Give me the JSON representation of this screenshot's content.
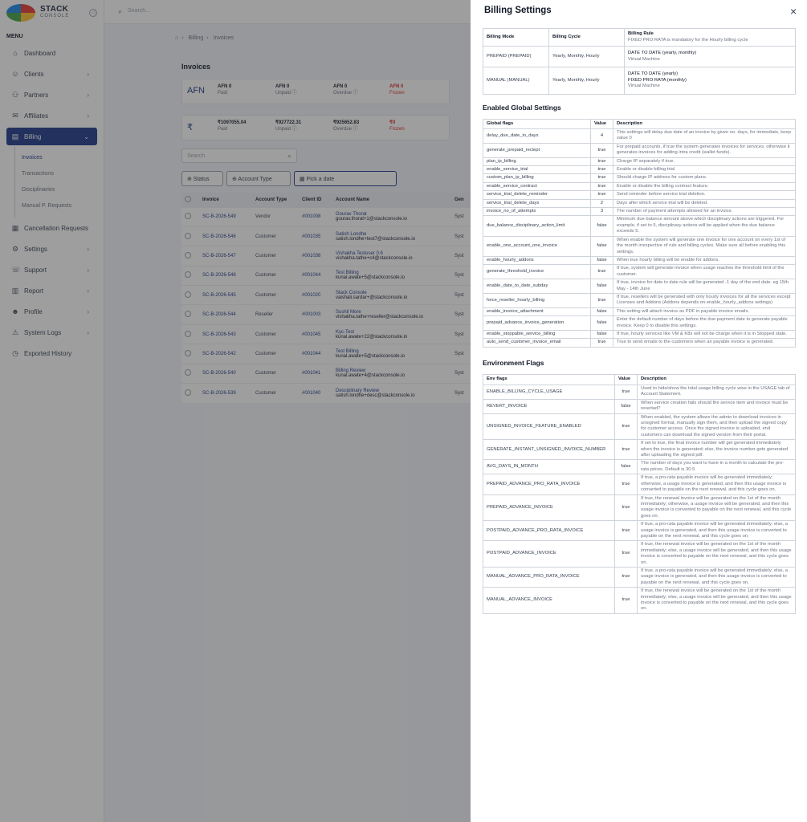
{
  "app": {
    "brand_line1": "STACK",
    "brand_line2": "CONSOLE",
    "menu_label": "MENU",
    "search_placeholder": "Search...",
    "nav": [
      {
        "label": "Dashboard",
        "icon": "home-icon",
        "glyph": "⌂",
        "chevron": false
      },
      {
        "label": "Clients",
        "icon": "user-icon",
        "glyph": "☺",
        "chevron": true
      },
      {
        "label": "Partners",
        "icon": "users-icon",
        "glyph": "⚇",
        "chevron": true
      },
      {
        "label": "Affiliates",
        "icon": "handshake-icon",
        "glyph": "✉",
        "chevron": true
      },
      {
        "label": "Billing",
        "icon": "billing-icon",
        "glyph": "▤",
        "chevron": true,
        "active": true
      },
      {
        "label": "Cancellation Requests",
        "icon": "cancel-icon",
        "glyph": "▦",
        "chevron": false
      },
      {
        "label": "Settings",
        "icon": "gear-icon",
        "glyph": "⚙",
        "chevron": true
      },
      {
        "label": "Support",
        "icon": "headset-icon",
        "glyph": "☏",
        "chevron": true
      },
      {
        "label": "Report",
        "icon": "report-icon",
        "glyph": "▥",
        "chevron": true
      },
      {
        "label": "Profile",
        "icon": "profile-icon",
        "glyph": "☻",
        "chevron": true
      },
      {
        "label": "System Logs",
        "icon": "warning-icon",
        "glyph": "⚠",
        "chevron": true
      },
      {
        "label": "Exported History",
        "icon": "history-icon",
        "glyph": "◷",
        "chevron": false
      }
    ],
    "billing_sub": [
      "Invoices",
      "Transactions",
      "Disciplinaries",
      "Manual P. Requests"
    ],
    "breadcrumb": [
      "Billing",
      "Invoices"
    ],
    "page_title": "Invoices",
    "cards": [
      {
        "currency": "AFN",
        "stats": [
          {
            "value": "AFN 0",
            "label": "Paid"
          },
          {
            "value": "AFN 0",
            "label": "Unpaid ⓘ"
          },
          {
            "value": "AFN 0",
            "label": "Overdue ⓘ"
          },
          {
            "value": "AFN 0",
            "label": "Frozen",
            "red": true
          }
        ]
      },
      {
        "currency": "₹",
        "stats": [
          {
            "value": "₹1097055.04",
            "label": "Paid"
          },
          {
            "value": "₹927722.31",
            "label": "Unpaid ⓘ"
          },
          {
            "value": "₹925652.83",
            "label": "Overdue ⓘ"
          },
          {
            "value": "₹0",
            "label": "Frozen",
            "red": true
          }
        ]
      }
    ],
    "search_label": "Search",
    "filters": [
      "⊕  Status",
      "⊕  Account Type",
      "▦  Pick a date"
    ],
    "table_headers": [
      "",
      "Invoice",
      "Account Type",
      "Client ID",
      "Account Name",
      "Gen"
    ],
    "rows": [
      {
        "invoice": "SC-B-2026-549",
        "type": "Vendor",
        "cid": "#001008",
        "name": "Gourav Thorat",
        "email": "gourav.thorat+1@stackconsole.io",
        "gen": "Syst"
      },
      {
        "invoice": "SC-B-2026-546",
        "type": "Customer",
        "cid": "#001035",
        "name": "Satish Londhe",
        "email": "satish.londhe+test7@stackconsole.io",
        "gen": "Syst"
      },
      {
        "invoice": "SC-B-2026-547",
        "type": "Customer",
        "cid": "#001038",
        "name": "Vishakha Testuser 0.6",
        "email": "vishakha.tathe+c4@stackconsole.io",
        "gen": "Syst"
      },
      {
        "invoice": "SC-B-2026-548",
        "type": "Customer",
        "cid": "#001044",
        "name": "Test Billing",
        "email": "kunal.awate+5@stackconsole.io",
        "gen": "Syst"
      },
      {
        "invoice": "SC-B-2026-545",
        "type": "Customer",
        "cid": "#001020",
        "name": "Stack Console",
        "email": "vaishali.sardar+@stackconsole.io",
        "gen": "Syst"
      },
      {
        "invoice": "SC-B-2026-544",
        "type": "Reseller",
        "cid": "#001003",
        "name": "Sushil More",
        "email": "vishakha.tathe+reseller@stackconsole.io",
        "gen": "Syst"
      },
      {
        "invoice": "SC-B-2026-543",
        "type": "Customer",
        "cid": "#001045",
        "name": "Kyc-Test",
        "email": "kunal.awate+22@stackconsole.in",
        "gen": "Syst"
      },
      {
        "invoice": "SC-B-2026-542",
        "type": "Customer",
        "cid": "#001044",
        "name": "Test Billing",
        "email": "kunal.awate+5@stackconsole.io",
        "gen": "Syst"
      },
      {
        "invoice": "SC-B-2026-540",
        "type": "Customer",
        "cid": "#001041",
        "name": "Billing Review",
        "email": "kunal.awate+4@stackconsole.io",
        "gen": "Syst"
      },
      {
        "invoice": "SC-B-2026-539",
        "type": "Customer",
        "cid": "#001040",
        "name": "Desciplinary Review",
        "email": "satish.londhe+desc@stackconsole.io",
        "gen": "Syst"
      }
    ]
  },
  "drawer": {
    "title": "Billing Settings",
    "close_label": "×",
    "billing_table": {
      "headers": [
        "Billing Mode",
        "Billing Cycle",
        "Billing Rule"
      ],
      "header_note": "FIXED PRO RATA is mandatory for the Hourly billing cycle",
      "rows": [
        {
          "mode": "PREPAID (PREPAID)",
          "cycle": "Yearly, Monthly, Hourly",
          "rule": [
            "DATE TO DATE (yearly, monthly)"
          ],
          "sub": "Virtual Machine"
        },
        {
          "mode": "MANUAL (MANUAL)",
          "cycle": "Yearly, Monthly, Hourly",
          "rule": [
            "DATE TO DATE (yearly)",
            "FIXED PRO RATA (monthly)"
          ],
          "sub": "Virtual Machine"
        }
      ]
    },
    "global_title": "Enabled Global Settings",
    "global_headers": [
      "Global flags",
      "Value",
      "Description"
    ],
    "global_rows": [
      {
        "flag": "delay_due_date_in_days",
        "value": "4",
        "desc": "This settings will delay due date of an invoice by given no. days, for immediate, keep value 0"
      },
      {
        "flag": "generate_prepaid_reciept",
        "value": "true",
        "desc": "For prepaid accounts, if true the system generates invoices for services, otherwise it generates invoices for adding intra credit (wallet funds)."
      },
      {
        "flag": "plan_ip_billing",
        "value": "true",
        "desc": "Charge IP separately if true."
      },
      {
        "flag": "enable_service_trial",
        "value": "true",
        "desc": "Enable or disable billing trial"
      },
      {
        "flag": "custom_plan_ip_billing",
        "value": "true",
        "desc": "Should charge IP address for custom plans."
      },
      {
        "flag": "enable_service_contract",
        "value": "true",
        "desc": "Enable or disable the billing contract feature."
      },
      {
        "flag": "service_trial_delete_reminder",
        "value": "true",
        "desc": "Send reminder before service trial deletion."
      },
      {
        "flag": "service_trial_delete_days",
        "value": "2",
        "desc": "Days after which service trial will be deleted."
      },
      {
        "flag": "invoice_no_of_attempts",
        "value": "3",
        "desc": "The number of payment attempts allowed for an invoice."
      },
      {
        "flag": "due_balance_disciplinary_action_limit",
        "value": "false",
        "desc": "Minimum due balance amount above which disciplinary actions are triggered. For example, if set to 5, disciplinary actions will be applied when the due balance exceeds 5."
      },
      {
        "flag": "enable_one_account_one_invoice",
        "value": "false",
        "desc": "When enable the system will generate one invoice for one account on every 1st of the month irrespective of rule and billing cycles. Make sure all before enabling this settings."
      },
      {
        "flag": "enable_hourly_addons",
        "value": "false",
        "desc": "When true hourly billing will be enable for addons."
      },
      {
        "flag": "generate_threshold_invoice",
        "value": "true",
        "desc": "If true, system will generate invoice when usage reaches the threshold limit of the customer."
      },
      {
        "flag": "enable_date_to_date_subday",
        "value": "false",
        "desc": "If true, invoice for date to date rule will be generated -1 day of the end date. eg 15th May - 14th June"
      },
      {
        "flag": "force_reseller_hourly_billing",
        "value": "true",
        "desc": "If true, resellers will be generated with only hourly invoices for all the services except Licenses and Addons (Addons depends on enable_hourly_addons settings)"
      },
      {
        "flag": "enable_invoice_attachment",
        "value": "false",
        "desc": "This setting will attach invoice as PDF in payable invoice emails."
      },
      {
        "flag": "prepaid_advance_invoice_generation",
        "value": "false",
        "desc": "Enter the default number of days before the due payment date to generate payable invoice. Keep 0 to disable this settings."
      },
      {
        "flag": "enable_stoppable_service_billing",
        "value": "false",
        "desc": "If true, hourly services like VM & K8s will not be charge when it is in Stopped state."
      },
      {
        "flag": "auto_send_customer_invoice_email",
        "value": "true",
        "desc": "True to send emails to the customers when an payable invoice is generated."
      }
    ],
    "env_title": "Environment Flags",
    "env_headers": [
      "Env flags",
      "Value",
      "Description"
    ],
    "env_rows": [
      {
        "flag": "ENABLE_BILLING_CYCLE_USAGE",
        "value": "true",
        "desc": "Used to hide/show the total usage billing cycle wise in the USAGE tab of Account Statement."
      },
      {
        "flag": "REVERT_INVOICE",
        "value": "false",
        "desc": "When service creation fails should the service item and invoice must be reverted?"
      },
      {
        "flag": "UNSIGNED_INVOICE_FEATURE_ENABLED",
        "value": "true",
        "desc": "When enabled, the system allows the admin to download invoices in unsigned format, manually sign them, and then upload the signed copy for customer access. Once the signed invoice is uploaded, end customers can download the signed version from their portal."
      },
      {
        "flag": "GENERATE_INSTANT_UNSIGNED_INVOICE_NUMBER",
        "value": "true",
        "desc": "If set to true, the final invoice number will get generated immediately when the invoice is generated; else, the invoice number gets generated after uploading the signed pdf."
      },
      {
        "flag": "AVG_DAYS_IN_MONTH",
        "value": "false",
        "desc": "The number of days you want to have in a month to calculate the pro-rata prices. Default is 30.5"
      },
      {
        "flag": "PREPAID_ADVANCE_PRO_RATA_INVOICE",
        "value": "true",
        "desc": "If true, a pro-rata payable invoice will be generated immediately; otherwise, a usage invoice is generated, and then this usage invoice is converted to payable on the next renewal, and this cycle goes on."
      },
      {
        "flag": "PREPAID_ADVANCE_INVOICE",
        "value": "true",
        "desc": "If true, the renewal invoice will be generated on the 1st of the month immediately; otherwise, a usage invoice will be generated, and then this usage invoice is converted to payable on the next renewal, and this cycle goes on."
      },
      {
        "flag": "POSTPAID_ADVANCE_PRO_RATA_INVOICE",
        "value": "true",
        "desc": "If true, a pro-rata payable invoice will be generated immediately; else, a usage invoice is generated, and then this usage invoice is converted to payable on the next renewal, and this cycle goes on."
      },
      {
        "flag": "POSTPAID_ADVANCE_INVOICE",
        "value": "true",
        "desc": "If true, the renewal invoice will be generated on the 1st of the month immediately; else, a usage invoice will be generated, and then this usage invoice is converted to payable on the next renewal, and this cycle goes on."
      },
      {
        "flag": "MANUAL_ADVANCE_PRO_RATA_INVOICE",
        "value": "true",
        "desc": "If true, a pro-rata payable invoice will be generated immediately; else, a usage invoice is generated, and then this usage invoice is converted to payable on the next renewal, and this cycle goes on."
      },
      {
        "flag": "MANUAL_ADVANCE_INVOICE",
        "value": "true",
        "desc": "If true, the renewal invoice will be generated on the 1st of the month immediately; else, a usage invoice will be generated, and then this usage invoice is converted to payable on the next renewal, and this cycle goes on."
      }
    ]
  },
  "colors": {
    "accent": "#1e3a8a",
    "overlay": "rgba(40,40,40,0.45)",
    "danger": "#dc2626"
  }
}
